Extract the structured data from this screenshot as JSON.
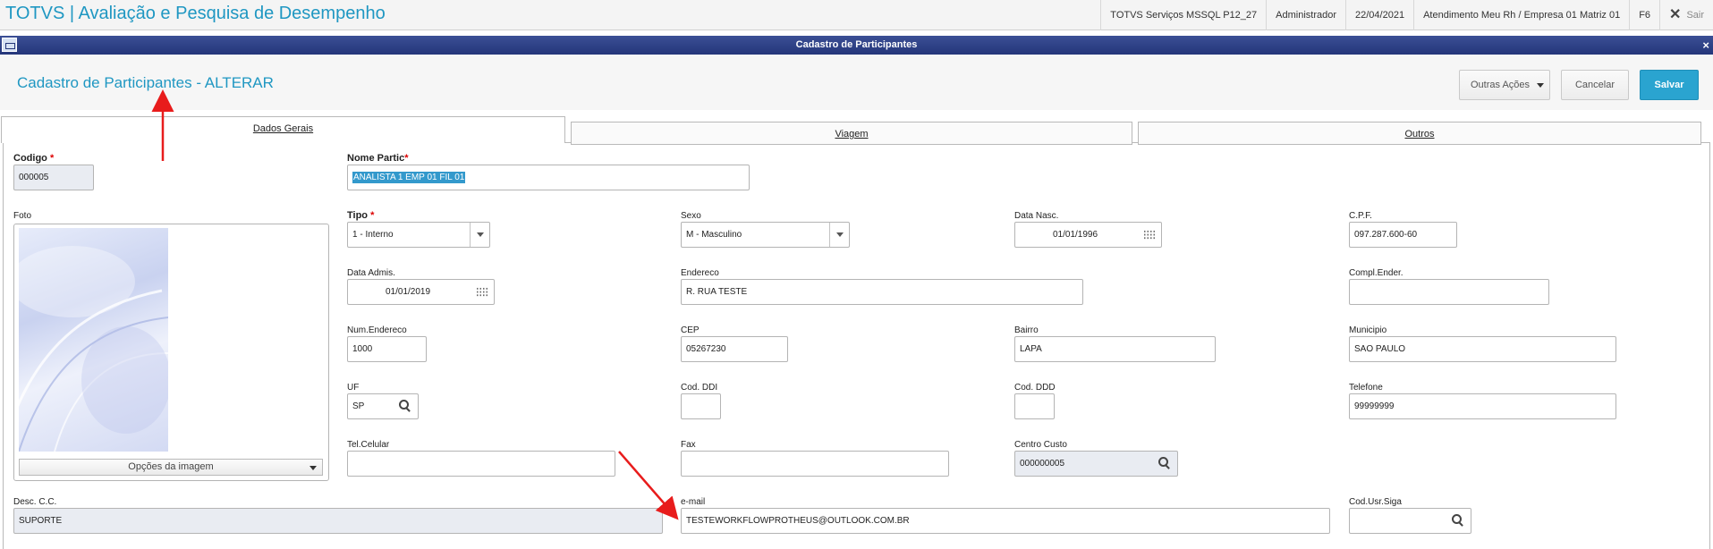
{
  "app": {
    "title": "TOTVS | Avaliação e Pesquisa de Desempenho",
    "environment": "TOTVS Serviços MSSQL P12_27",
    "user": "Administrador",
    "date": "22/04/2021",
    "branch": "Atendimento Meu Rh / Empresa 01 Matriz 01",
    "f6": "F6",
    "exit_label": "Sair"
  },
  "dialog": {
    "title": "Cadastro de Participantes",
    "close": "×",
    "page_title": "Cadastro de Participantes - ALTERAR",
    "buttons": {
      "more_actions": "Outras Ações",
      "cancel": "Cancelar",
      "save": "Salvar"
    }
  },
  "tabs": [
    {
      "label": "Dados Gerais",
      "active": true
    },
    {
      "label": "Viagem",
      "active": false
    },
    {
      "label": "Outros",
      "active": false
    }
  ],
  "fields": {
    "codigo": {
      "label": "Codigo",
      "required": "*",
      "value": "000005"
    },
    "nome": {
      "label": "Nome Partic",
      "required": "*",
      "value": "ANALISTA 1 EMP 01 FIL 01"
    },
    "foto": {
      "label": "Foto",
      "options_label": "Opções da imagem"
    },
    "tipo": {
      "label": "Tipo",
      "required": "*",
      "value": "1 - Interno"
    },
    "sexo": {
      "label": "Sexo",
      "value": "M - Masculino"
    },
    "data_nasc": {
      "label": "Data Nasc.",
      "value": "01/01/1996"
    },
    "cpf": {
      "label": "C.P.F.",
      "value": "097.287.600-60"
    },
    "data_admis": {
      "label": "Data Admis.",
      "value": "01/01/2019"
    },
    "endereco": {
      "label": "Endereco",
      "value": "R. RUA TESTE"
    },
    "compl_ender": {
      "label": "Compl.Ender.",
      "value": ""
    },
    "num_endereco": {
      "label": "Num.Endereco",
      "value": "1000"
    },
    "cep": {
      "label": "CEP",
      "value": "05267230"
    },
    "bairro": {
      "label": "Bairro",
      "value": "LAPA"
    },
    "municipio": {
      "label": "Municipio",
      "value": "SAO PAULO"
    },
    "uf": {
      "label": "UF",
      "value": "SP"
    },
    "cod_ddi": {
      "label": "Cod. DDI",
      "value": ""
    },
    "cod_ddd": {
      "label": "Cod. DDD",
      "value": ""
    },
    "telefone": {
      "label": "Telefone",
      "value": "99999999"
    },
    "tel_celular": {
      "label": "Tel.Celular",
      "value": ""
    },
    "fax": {
      "label": "Fax",
      "value": ""
    },
    "centro_custo": {
      "label": "Centro Custo",
      "value": "000000005"
    },
    "desc_cc": {
      "label": "Desc. C.C.",
      "value": "SUPORTE"
    },
    "email": {
      "label": "e-mail",
      "value": "TESTEWORKFLOWPROTHEUS@OUTLOOK.COM.BR"
    },
    "cod_usr_siga": {
      "label": "Cod.Usr.Siga",
      "value": ""
    }
  },
  "colors": {
    "accent": "#1f97c2",
    "titlebar": "#24367a",
    "save_button": "#2aa4d0",
    "annotation_arrow": "#e81c1c"
  }
}
